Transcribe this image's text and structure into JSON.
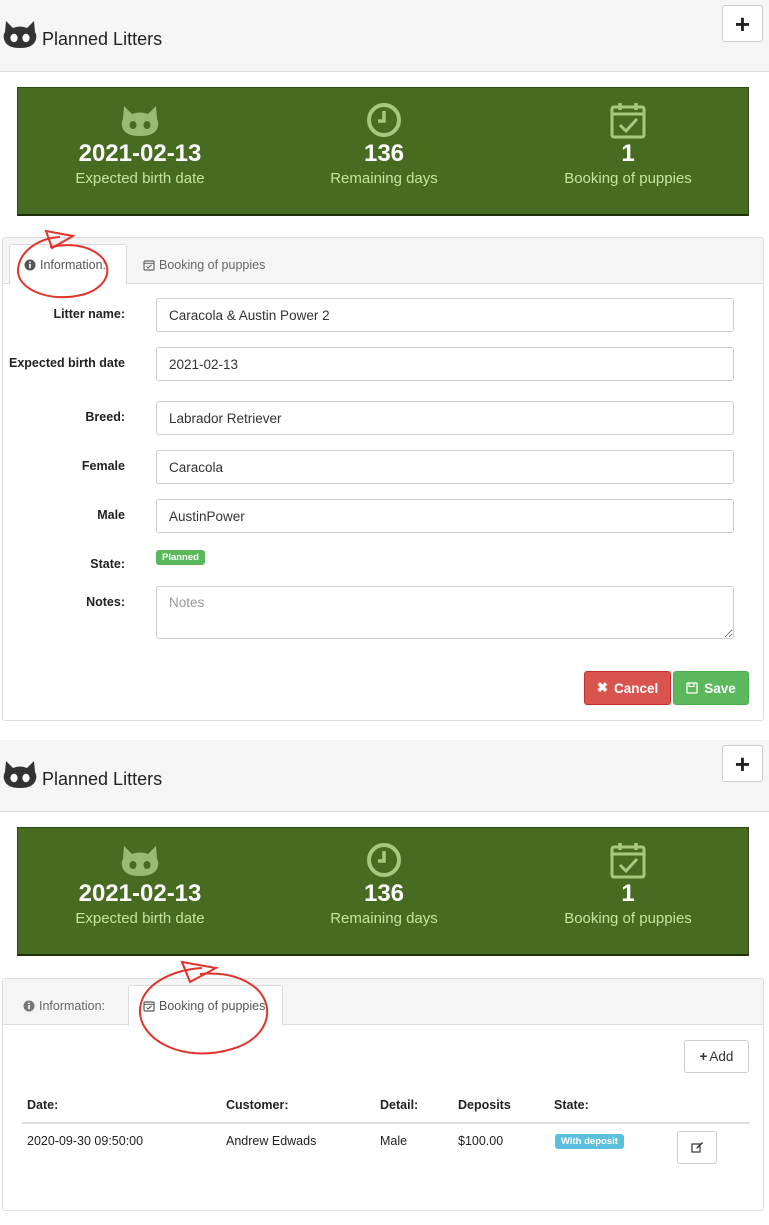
{
  "screen1": {
    "header": {
      "title": "Planned Litters",
      "add_icon": "plus-icon"
    },
    "stats": [
      {
        "value": "2021-02-13",
        "label": "Expected birth date",
        "icon": "cat-icon"
      },
      {
        "value": "136",
        "label": "Remaining days",
        "icon": "clock-icon"
      },
      {
        "value": "1",
        "label": "Booking of puppies",
        "icon": "calendar-check-icon"
      }
    ],
    "tabs": [
      {
        "label": "Information:",
        "icon": "info-icon",
        "active": true
      },
      {
        "label": "Booking of puppies",
        "icon": "calendar-check-icon",
        "active": false
      }
    ],
    "form": {
      "litter_name": {
        "label": "Litter name:",
        "value": "Caracola & Austin Power 2"
      },
      "expected_birth_date": {
        "label": "Expected birth date",
        "value": "2021-02-13"
      },
      "breed": {
        "label": "Breed:",
        "value": "Labrador Retriever"
      },
      "female": {
        "label": "Female",
        "value": "Caracola"
      },
      "male": {
        "label": "Male",
        "value": "AustinPower"
      },
      "state": {
        "label": "State:",
        "value": "Planned"
      },
      "notes": {
        "label": "Notes:",
        "placeholder": "Notes",
        "value": ""
      }
    },
    "actions": {
      "cancel": "Cancel",
      "save": "Save"
    }
  },
  "screen2": {
    "header": {
      "title": "Planned Litters",
      "add_icon": "plus-icon"
    },
    "stats": [
      {
        "value": "2021-02-13",
        "label": "Expected birth date",
        "icon": "cat-icon"
      },
      {
        "value": "136",
        "label": "Remaining days",
        "icon": "clock-icon"
      },
      {
        "value": "1",
        "label": "Booking of puppies",
        "icon": "calendar-check-icon"
      }
    ],
    "tabs": [
      {
        "label": "Information:",
        "icon": "info-icon",
        "active": false
      },
      {
        "label": "Booking of puppies",
        "icon": "calendar-check-icon",
        "active": true
      }
    ],
    "add_button": "Add",
    "table": {
      "columns": [
        "Date:",
        "Customer:",
        "Detail:",
        "Deposits",
        "State:"
      ],
      "rows": [
        {
          "date": "2020-09-30 09:50:00",
          "customer": "Andrew Edwads",
          "detail": "Male",
          "deposits": "$100.00",
          "state": "With deposit"
        }
      ]
    }
  },
  "colors": {
    "stats_bg": "#486b22",
    "stats_label": "#c7e39c",
    "cancel": "#d9534f",
    "save": "#5cb85c",
    "planned_badge": "#5cb85c",
    "deposit_badge": "#5bc0de",
    "annotation": "#e0342c"
  }
}
